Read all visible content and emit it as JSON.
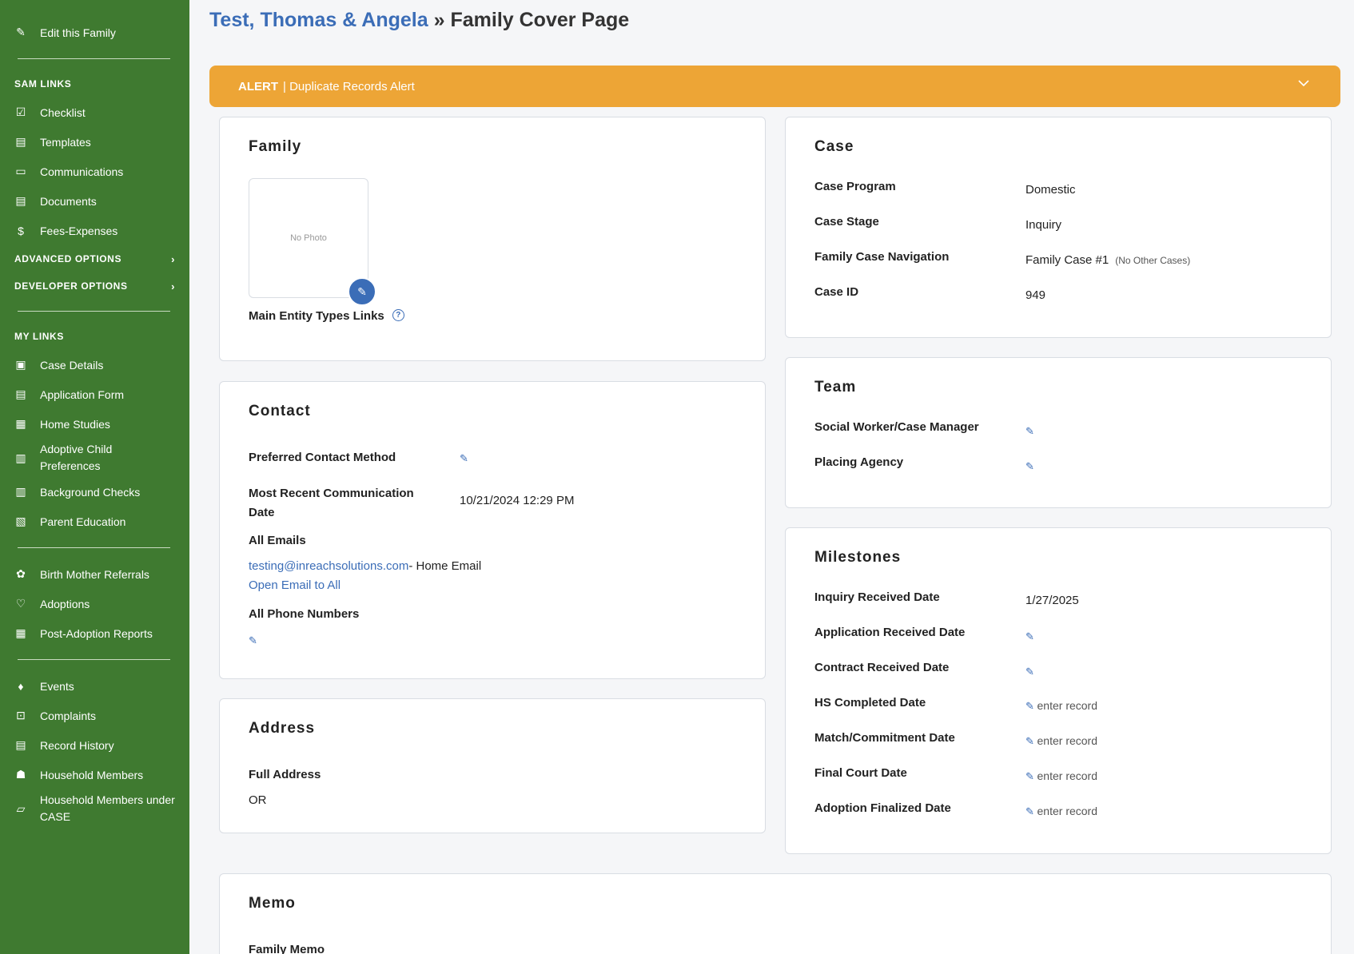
{
  "sidebar": {
    "edit_family": "Edit this Family",
    "sam_links_heading": "SAM LINKS",
    "sam_links": [
      "Checklist",
      "Templates",
      "Communications",
      "Documents",
      "Fees-Expenses"
    ],
    "advanced_options": "ADVANCED OPTIONS",
    "developer_options": "DEVELOPER OPTIONS",
    "my_links_heading": "MY LINKS",
    "my_links": [
      "Case Details",
      "Application Form",
      "Home Studies",
      "Adoptive Child Preferences",
      "Background Checks",
      "Parent Education"
    ],
    "group2": [
      "Birth Mother Referrals",
      "Adoptions",
      "Post-Adoption Reports"
    ],
    "group3": [
      "Events",
      "Complaints",
      "Record History",
      "Household Members",
      "Household Members under CASE"
    ]
  },
  "header": {
    "family_link": "Test, Thomas & Angela",
    "separator": "»",
    "page_name": "Family Cover Page"
  },
  "alert": {
    "label": "ALERT",
    "text": "| Duplicate Records Alert"
  },
  "family": {
    "title": "Family",
    "no_photo": "No Photo",
    "entity_types_label": "Main Entity Types Links",
    "help": "?"
  },
  "contact": {
    "title": "Contact",
    "preferred_label": "Preferred Contact Method",
    "recent_label_1": "Most Recent Communication",
    "recent_label_2": "Date",
    "recent_value": "10/21/2024 12:29 PM",
    "emails_label": "All Emails",
    "email": "testing@inreachsolutions.com",
    "email_type": " - Home Email",
    "open_email": "Open Email to All",
    "phones_label": "All Phone Numbers"
  },
  "address": {
    "title": "Address",
    "full_label": "Full Address",
    "value": "OR"
  },
  "case": {
    "title": "Case",
    "program_label": "Case Program",
    "program_value": "Domestic",
    "stage_label": "Case Stage",
    "stage_value": "Inquiry",
    "nav_label": "Family Case Navigation",
    "nav_value": "Family Case #1",
    "nav_note": "(No Other Cases)",
    "id_label": "Case ID",
    "id_value": "949"
  },
  "team": {
    "title": "Team",
    "social_worker_label": "Social Worker/Case Manager",
    "placing_agency_label": "Placing Agency"
  },
  "milestones": {
    "title": "Milestones",
    "inquiry_label": "Inquiry Received Date",
    "inquiry_value": "1/27/2025",
    "application_label": "Application Received Date",
    "contract_label": "Contract Received Date",
    "hs_label": "HS Completed Date",
    "match_label": "Match/Commitment Date",
    "court_label": "Final Court Date",
    "finalized_label": "Adoption Finalized Date",
    "enter_record": "enter record"
  },
  "memo": {
    "title": "Memo",
    "family_memo_label": "Family Memo"
  }
}
